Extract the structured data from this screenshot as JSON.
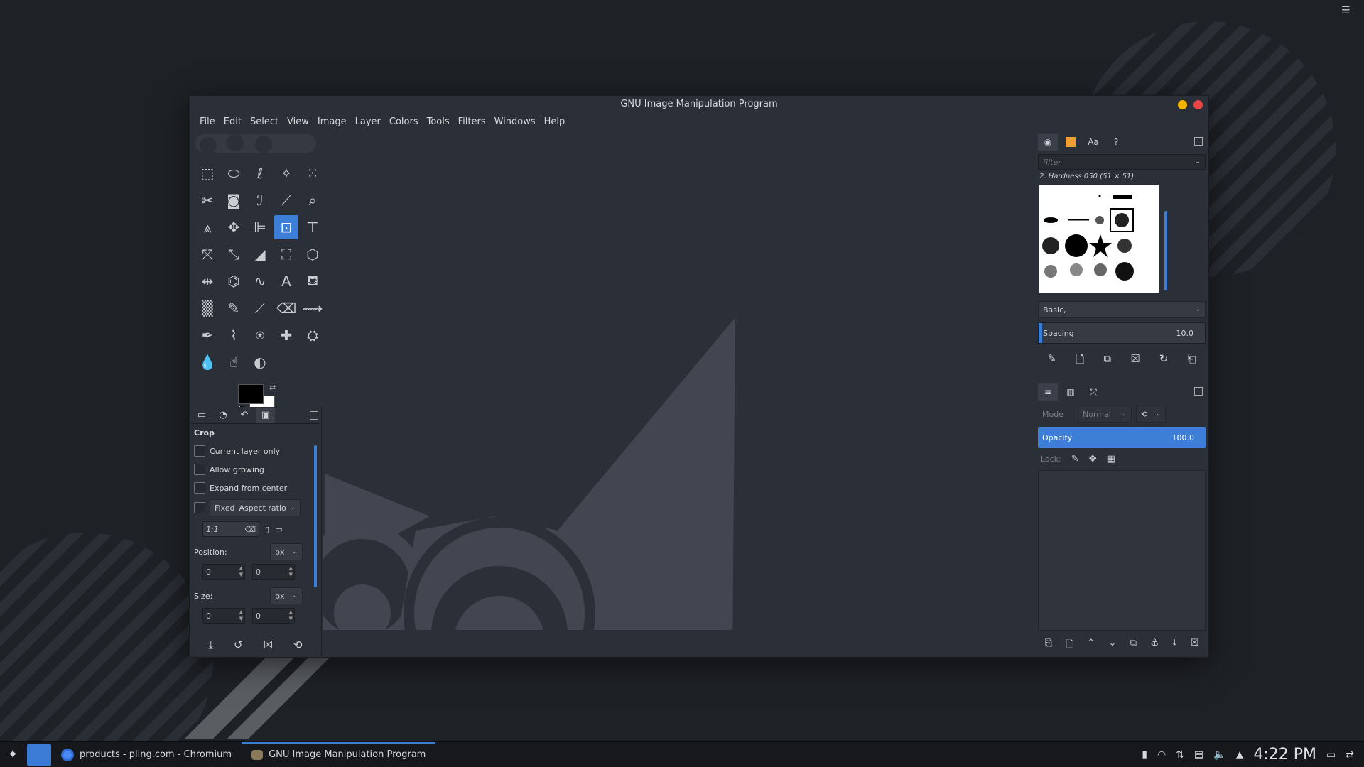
{
  "window": {
    "title": "GNU Image Manipulation Program"
  },
  "menu": [
    "File",
    "Edit",
    "Select",
    "View",
    "Image",
    "Layer",
    "Colors",
    "Tools",
    "Filters",
    "Windows",
    "Help"
  ],
  "tools": [
    "rect-select-icon",
    "ellipse-select-icon",
    "free-select-icon",
    "fuzzy-select-icon",
    "select-by-color-icon",
    "scissors-select-icon",
    "foreground-select-icon",
    "paths-icon",
    "color-picker-icon",
    "zoom-icon",
    "measure-icon",
    "move-icon",
    "align-icon",
    "crop-icon",
    "unified-transform-icon",
    "warp-transform-icon",
    "scale-icon",
    "shear-icon",
    "perspective-icon",
    "3d-transform-icon",
    "flip-icon",
    "cage-transform-icon",
    "warp-icon",
    "text-icon",
    "bucket-fill-icon",
    "gradient-icon",
    "pencil-icon",
    "paintbrush-icon",
    "eraser-icon",
    "airbrush-icon",
    "ink-icon",
    "mypaint-brush-icon",
    "clone-icon",
    "heal-icon",
    "perspective-clone-icon",
    "blur-icon",
    "smudge-icon",
    "dodge-burn-icon"
  ],
  "active_tool_index": 13,
  "tool_options": {
    "title": "Crop",
    "current_layer_only": "Current layer only",
    "allow_growing": "Allow growing",
    "expand_from_center": "Expand from center",
    "fixed_label": "Fixed",
    "fixed_mode": "Aspect ratio",
    "ratio_value": "1:1",
    "position_label": "Position:",
    "position_unit": "px",
    "position_x": "0",
    "position_y": "0",
    "size_label": "Size:",
    "size_unit": "px",
    "size_w": "0",
    "size_h": "0"
  },
  "brushes": {
    "filter_placeholder": "filter",
    "selected_brush": "2. Hardness 050 (51 × 51)",
    "preset": "Basic,",
    "spacing_label": "Spacing",
    "spacing_value": "10.0",
    "spacing_fraction": 0.02
  },
  "layers": {
    "mode_label": "Mode",
    "mode_value": "Normal",
    "opacity_label": "Opacity",
    "opacity_value": "100.0",
    "lock_label": "Lock:"
  },
  "taskbar": {
    "task1": "products - pling.com - Chromium",
    "task2": "GNU Image Manipulation Program",
    "clock": "4:22 PM"
  },
  "colors": {
    "accent": "#3d7fd6",
    "foreground": "#000000",
    "background": "#ffffff"
  }
}
